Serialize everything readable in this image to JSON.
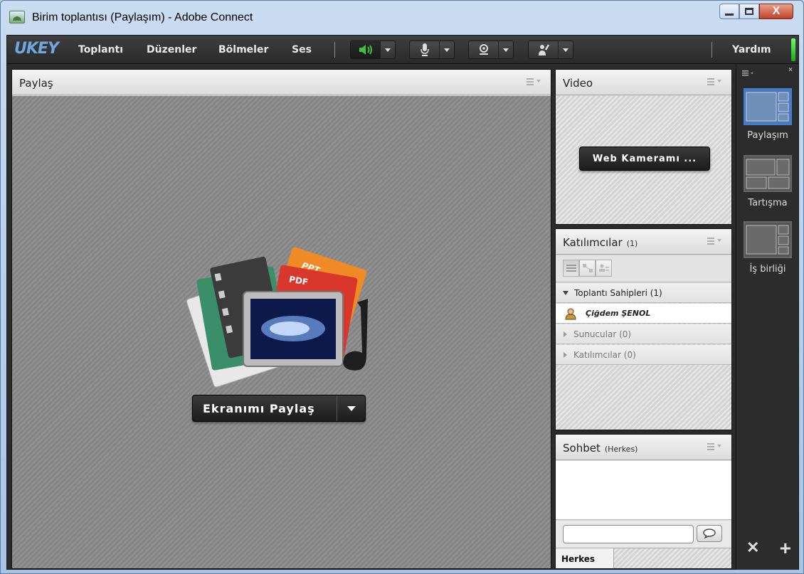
{
  "window": {
    "title": "Birim toplantısı (Paylaşım) - Adobe Connect",
    "close_glyph": "X"
  },
  "menubar": {
    "logo": "UKEY",
    "items": [
      "Toplantı",
      "Düzenler",
      "Bölmeler",
      "Ses"
    ],
    "help": "Yardım",
    "toolbar_icons": [
      "speaker-icon",
      "microphone-icon",
      "webcam-icon",
      "raise-hand-icon"
    ],
    "accent_green": "#3ec23e"
  },
  "share_pod": {
    "title": "Paylaş",
    "share_button": "Ekranımı Paylaş",
    "card_labels": {
      "ppt": "PPT",
      "pdf": "PDF"
    }
  },
  "video_pod": {
    "title": "Video",
    "button": "Web Kameramı ..."
  },
  "attendees_pod": {
    "title": "Katılımcılar",
    "count": "(1)",
    "groups": [
      {
        "label": "Toplantı Sahipleri (1)",
        "expanded": true,
        "members": [
          "Çiğdem ŞENOL"
        ]
      },
      {
        "label": "Sunucular (0)",
        "expanded": false
      },
      {
        "label": "Katılımcılar (0)",
        "expanded": false
      }
    ]
  },
  "chat_pod": {
    "title": "Sohbet",
    "scope": "(Herkes)",
    "input_value": "",
    "tab": "Herkes"
  },
  "layouts": {
    "items": [
      {
        "label": "Paylaşım",
        "selected": true
      },
      {
        "label": "Tartışma",
        "selected": false
      },
      {
        "label": "İş birliği",
        "selected": false
      }
    ],
    "tools_glyph": "✕",
    "add_glyph": "+"
  }
}
